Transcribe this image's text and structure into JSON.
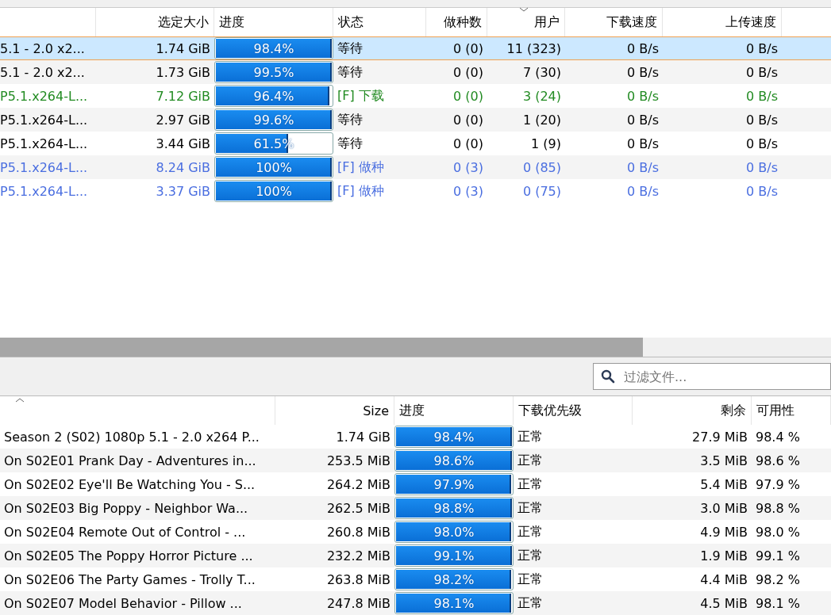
{
  "torrents": {
    "columns": [
      {
        "label": "选定大小",
        "sorted": false
      },
      {
        "label": "进度",
        "sorted": false
      },
      {
        "label": "状态",
        "sorted": false
      },
      {
        "label": "做种数",
        "sorted": false
      },
      {
        "label": "用户",
        "sorted": true
      },
      {
        "label": "下载速度",
        "sorted": false
      },
      {
        "label": "上传速度",
        "sorted": false
      }
    ],
    "rows": [
      {
        "name": "5.1 - 2.0 x2...",
        "size": "1.74 GiB",
        "progress": "98.4%",
        "level": 0.984,
        "status": "等待",
        "seeds": "0 (0)",
        "peers": "11 (323)",
        "down": "0 B/s",
        "up": "0 B/s",
        "color": "#000000",
        "selected": true
      },
      {
        "name": "5.1 - 2.0 x2...",
        "size": "1.73 GiB",
        "progress": "99.5%",
        "level": 0.995,
        "status": "等待",
        "seeds": "0 (0)",
        "peers": "7 (30)",
        "down": "0 B/s",
        "up": "0 B/s",
        "color": "#000000",
        "selected": false
      },
      {
        "name": "P5.1.x264-L...",
        "size": "7.12 GiB",
        "progress": "96.4%",
        "level": 0.964,
        "status": "[F] 下载",
        "seeds": "0 (0)",
        "peers": "3 (24)",
        "down": "0 B/s",
        "up": "0 B/s",
        "color": "#228b22",
        "selected": false
      },
      {
        "name": "P5.1.x264-L...",
        "size": "2.97 GiB",
        "progress": "99.6%",
        "level": 0.996,
        "status": "等待",
        "seeds": "0 (0)",
        "peers": "1 (20)",
        "down": "0 B/s",
        "up": "0 B/s",
        "color": "#000000",
        "selected": false
      },
      {
        "name": "P5.1.x264-L...",
        "size": "3.44 GiB",
        "progress": "61.5%",
        "level": 0.615,
        "status": "等待",
        "seeds": "0 (0)",
        "peers": "1 (9)",
        "down": "0 B/s",
        "up": "0 B/s",
        "color": "#000000",
        "selected": false
      },
      {
        "name": "P5.1.x264-L...",
        "size": "8.24 GiB",
        "progress": "100%",
        "level": 1,
        "status": "[F] 做种",
        "seeds": "0 (3)",
        "peers": "0 (85)",
        "down": "0 B/s",
        "up": "0 B/s",
        "color": "#4a6ee0",
        "selected": false
      },
      {
        "name": "P5.1.x264-L...",
        "size": "3.37 GiB",
        "progress": "100%",
        "level": 1,
        "status": "[F] 做种",
        "seeds": "0 (3)",
        "peers": "0 (75)",
        "down": "0 B/s",
        "up": "0 B/s",
        "color": "#4a6ee0",
        "selected": false
      }
    ]
  },
  "filter": {
    "placeholder": "过滤文件..."
  },
  "files": {
    "columns": [
      {
        "sorted": true
      },
      {
        "label": "Size",
        "sorted": false
      },
      {
        "label": "进度",
        "sorted": false
      },
      {
        "label": "下载优先级",
        "sorted": false
      },
      {
        "label": "剩余",
        "sorted": false
      },
      {
        "label": "可用性",
        "sorted": false
      }
    ],
    "rows": [
      {
        "name": "Season 2 (S02) 1080p 5.1 - 2.0 x264 P...",
        "size": "1.74 GiB",
        "progress": "98.4%",
        "level": 0.984,
        "priority": "正常",
        "remaining": "27.9 MiB",
        "availability": "98.4 %"
      },
      {
        "name": "On S02E01 Prank Day - Adventures in...",
        "size": "253.5 MiB",
        "progress": "98.6%",
        "level": 0.986,
        "priority": "正常",
        "remaining": "3.5 MiB",
        "availability": "98.6 %"
      },
      {
        "name": "On S02E02 Eye'll Be Watching You - S...",
        "size": "264.2 MiB",
        "progress": "97.9%",
        "level": 0.979,
        "priority": "正常",
        "remaining": "5.4 MiB",
        "availability": "97.9 %"
      },
      {
        "name": "On S02E03 Big Poppy - Neighbor Wa...",
        "size": "262.5 MiB",
        "progress": "98.8%",
        "level": 0.988,
        "priority": "正常",
        "remaining": "3.0 MiB",
        "availability": "98.8 %"
      },
      {
        "name": "On S02E04 Remote Out of Control - ...",
        "size": "260.8 MiB",
        "progress": "98.0%",
        "level": 0.98,
        "priority": "正常",
        "remaining": "4.9 MiB",
        "availability": "98.0 %"
      },
      {
        "name": "On S02E05 The Poppy Horror Picture ...",
        "size": "232.2 MiB",
        "progress": "99.1%",
        "level": 0.991,
        "priority": "正常",
        "remaining": "1.9 MiB",
        "availability": "99.1 %"
      },
      {
        "name": "On S02E06 The Party Games - Trolly T...",
        "size": "263.8 MiB",
        "progress": "98.2%",
        "level": 0.982,
        "priority": "正常",
        "remaining": "4.4 MiB",
        "availability": "98.2 %"
      },
      {
        "name": "On S02E07 Model Behavior - Pillow ...",
        "size": "247.8 MiB",
        "progress": "98.1%",
        "level": 0.981,
        "priority": "正常",
        "remaining": "4.5 MiB",
        "availability": "98.1 %"
      }
    ]
  }
}
